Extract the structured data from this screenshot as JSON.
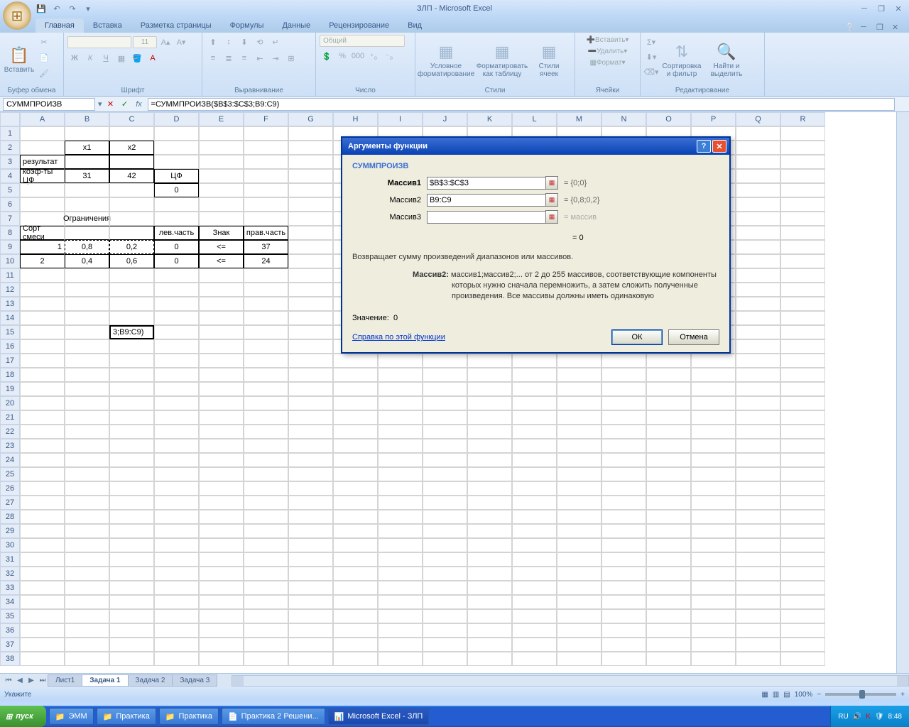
{
  "window": {
    "title": "ЗЛП - Microsoft Excel"
  },
  "quickAccess": {
    "save": "💾",
    "undo": "↶",
    "redo": "↷"
  },
  "tabs": [
    "Главная",
    "Вставка",
    "Разметка страницы",
    "Формулы",
    "Данные",
    "Рецензирование",
    "Вид"
  ],
  "ribbon": {
    "clipboard": {
      "title": "Буфер обмена",
      "paste": "Вставить"
    },
    "font": {
      "title": "Шрифт",
      "size": "11"
    },
    "alignment": {
      "title": "Выравнивание"
    },
    "number": {
      "title": "Число",
      "format": "Общий"
    },
    "styles": {
      "title": "Стили",
      "cond": "Условное форматирование",
      "table": "Форматировать как таблицу",
      "cell": "Стили ячеек"
    },
    "cells": {
      "title": "Ячейки",
      "insert": "Вставить",
      "delete": "Удалить",
      "format": "Формат"
    },
    "editing": {
      "title": "Редактирование",
      "sort": "Сортировка и фильтр",
      "find": "Найти и выделить"
    }
  },
  "formulaBar": {
    "nameBox": "СУММПРОИЗВ",
    "formula": "=СУММПРОИЗВ($B$3:$C$3;B9:C9)"
  },
  "columns": [
    "A",
    "B",
    "C",
    "D",
    "E",
    "F",
    "G",
    "H",
    "I",
    "J",
    "K",
    "L",
    "M",
    "N",
    "O",
    "P",
    "Q",
    "R"
  ],
  "cells": {
    "B2": "x1",
    "C2": "x2",
    "A3": "результат",
    "A4": "коэф-ты ЦФ",
    "B4": "31",
    "C4": "42",
    "D4": "ЦФ",
    "D5": "0",
    "B7": "Ограничения",
    "A8": "Сорт смеси",
    "D8": "лев.часть",
    "E8": "Знак",
    "F8": "прав.часть",
    "A9": "1",
    "B9": "0,8",
    "C9": "0,2",
    "D9": "0",
    "E9": "<=",
    "F9": "37",
    "A10": "2",
    "B10": "0,4",
    "C10": "0,6",
    "D10": "0",
    "E10": "<=",
    "F10": "24",
    "C15": "3;B9:C9)"
  },
  "sheetTabs": [
    "Лист1",
    "Задача 1",
    "Задача 2",
    "Задача 3"
  ],
  "sheetTabActive": 1,
  "statusBar": {
    "text": "Укажите",
    "zoom": "100%"
  },
  "dialog": {
    "title": "Аргументы функции",
    "funcName": "СУММПРОИЗВ",
    "args": {
      "a1": {
        "label": "Массив1",
        "value": "$B$3:$C$3",
        "result": "= {0;0}"
      },
      "a2": {
        "label": "Массив2",
        "value": "B9:C9",
        "result": "= {0,8;0,2}"
      },
      "a3": {
        "label": "Массив3",
        "value": "",
        "result": "= массив"
      }
    },
    "preview": "= 0",
    "description": "Возвращает сумму произведений диапазонов или массивов.",
    "argHelp": {
      "label": "Массив2:",
      "text": "массив1;массив2;... от 2 до 255 массивов, соответствующие компоненты которых нужно сначала перемножить, а затем сложить полученные произведения. Все массивы должны иметь одинаковую"
    },
    "valueLabel": "Значение:",
    "valueResult": "0",
    "link": "Справка по этой функции",
    "ok": "ОК",
    "cancel": "Отмена"
  },
  "taskbar": {
    "start": "пуск",
    "tasks": [
      "ЭММ",
      "Практика",
      "Практика",
      "Практика 2 Решени...",
      "Microsoft Excel - ЗЛП"
    ],
    "lang": "RU",
    "time": "8:48"
  }
}
